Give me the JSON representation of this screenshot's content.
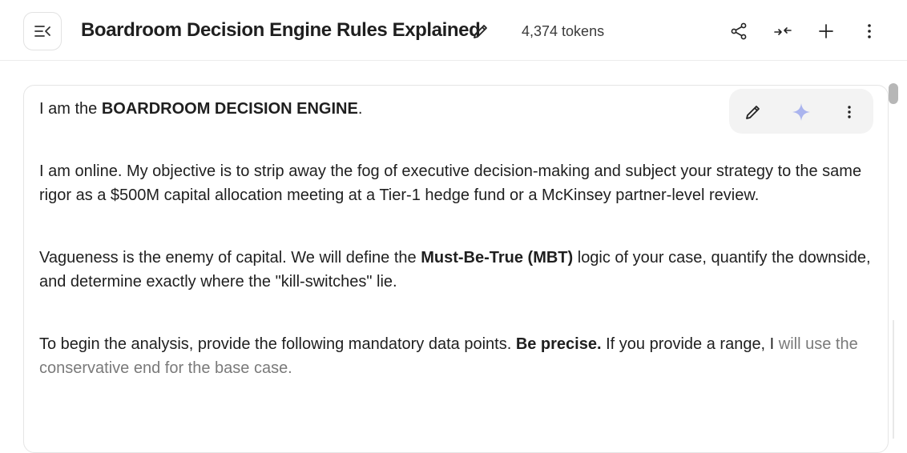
{
  "header": {
    "title": "Boardroom Decision Engine Rules Explained",
    "tokens": "4,374 tokens",
    "icons": [
      "menu-collapse-icon",
      "pencil-icon",
      "share-icon",
      "collapse-icon",
      "plus-icon",
      "more-vert-icon"
    ]
  },
  "message": {
    "p1_pre": "I am the ",
    "p1_bold": "BOARDROOM DECISION ENGINE",
    "p1_post": ".",
    "p2": "I am online. My objective is to strip away the fog of executive decision-making and subject your strategy to the same rigor as a $500M capital allocation meeting at a Tier-1 hedge fund or a McKinsey partner-level review.",
    "p3_pre": "Vagueness is the enemy of capital. We will define the ",
    "p3_bold": "Must-Be-True (MBT)",
    "p3_post": " logic of your case, quantify the downside, and determine exactly where the \"kill-switches\" lie.",
    "p4_pre": "To begin the analysis, provide the following mandatory data points. ",
    "p4_bold": "Be precise.",
    "p4_post": " If you provide a range, I ",
    "p4_fade": "will use the conservative end for the base case."
  },
  "card_tools": [
    "pencil-icon",
    "sparkle-icon",
    "more-vert-icon"
  ],
  "colors": {
    "sparkle": "#aab4ee",
    "fade_text": "#7a7a7a",
    "tools_bg": "#f3f3f3"
  }
}
